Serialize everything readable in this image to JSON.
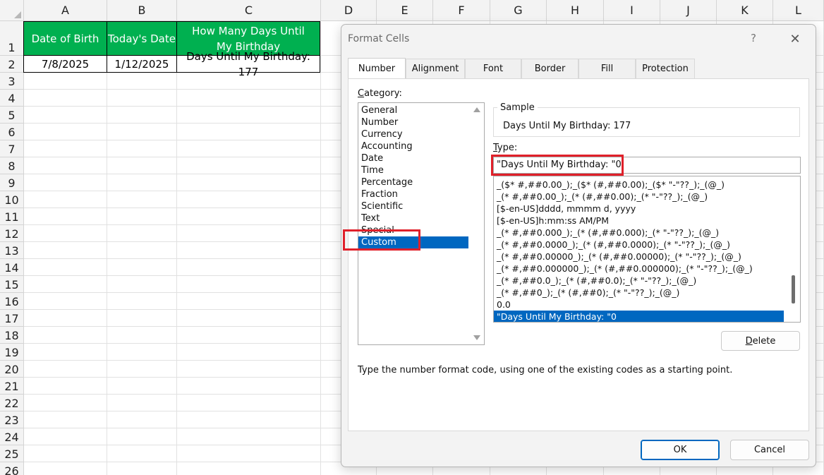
{
  "spreadsheet": {
    "columns": [
      "A",
      "B",
      "C",
      "D",
      "E",
      "F",
      "G",
      "H",
      "I",
      "J",
      "K",
      "L"
    ],
    "rows": [
      "1",
      "2",
      "3",
      "4",
      "5",
      "6",
      "7",
      "8",
      "9",
      "10",
      "11",
      "12",
      "13",
      "14",
      "15",
      "16",
      "17",
      "18",
      "19",
      "20",
      "21",
      "22",
      "23",
      "24",
      "25",
      "26"
    ],
    "header_row": {
      "a": "Date of Birth",
      "b": "Today's Date",
      "c": "How Many Days Until My Birthday"
    },
    "data_row": {
      "a": "7/8/2025",
      "b": "1/12/2025",
      "c": "Days Until My Birthday: 177"
    },
    "header_fill_color": "#00b050"
  },
  "dialog": {
    "title": "Format Cells",
    "help_label": "?",
    "close_label": "✕",
    "tabs": [
      "Number",
      "Alignment",
      "Font",
      "Border",
      "Fill",
      "Protection"
    ],
    "active_tab": "Number",
    "category_label_prefix": "",
    "category_label_accel": "C",
    "category_label_rest": "ategory:",
    "categories": [
      "General",
      "Number",
      "Currency",
      "Accounting",
      "Date",
      "Time",
      "Percentage",
      "Fraction",
      "Scientific",
      "Text",
      "Special",
      "Custom"
    ],
    "selected_category": "Custom",
    "sample_label": "Sample",
    "sample_value": "Days Until My Birthday: 177",
    "type_label_accel": "T",
    "type_label_rest": "ype:",
    "type_value": "\"Days Until My Birthday: \"0",
    "formats": [
      "_($* #,##0.00_);_($* (#,##0.00);_($* \"-\"??_);_(@_)",
      "_(* #,##0.00_);_(* (#,##0.00);_(* \"-\"??_);_(@_)",
      "[$-en-US]dddd, mmmm d, yyyy",
      "[$-en-US]h:mm:ss AM/PM",
      "_(* #,##0.000_);_(* (#,##0.000);_(* \"-\"??_);_(@_)",
      "_(* #,##0.0000_);_(* (#,##0.0000);_(* \"-\"??_);_(@_)",
      "_(* #,##0.00000_);_(* (#,##0.00000);_(* \"-\"??_);_(@_)",
      "_(* #,##0.000000_);_(* (#,##0.000000);_(* \"-\"??_);_(@_)",
      "_(* #,##0.0_);_(* (#,##0.0);_(* \"-\"??_);_(@_)",
      "_(* #,##0_);_(* (#,##0);_(* \"-\"??_);_(@_)",
      "0.0",
      "\"Days Until My Birthday: \"0"
    ],
    "selected_format": "\"Days Until My Birthday: \"0",
    "delete_label_accel": "D",
    "delete_label_rest": "elete",
    "hint": "Type the number format code, using one of the existing codes as a starting point.",
    "ok_label": "OK",
    "cancel_label": "Cancel",
    "highlight_color": "#e0202a",
    "selection_color": "#0067c0"
  }
}
